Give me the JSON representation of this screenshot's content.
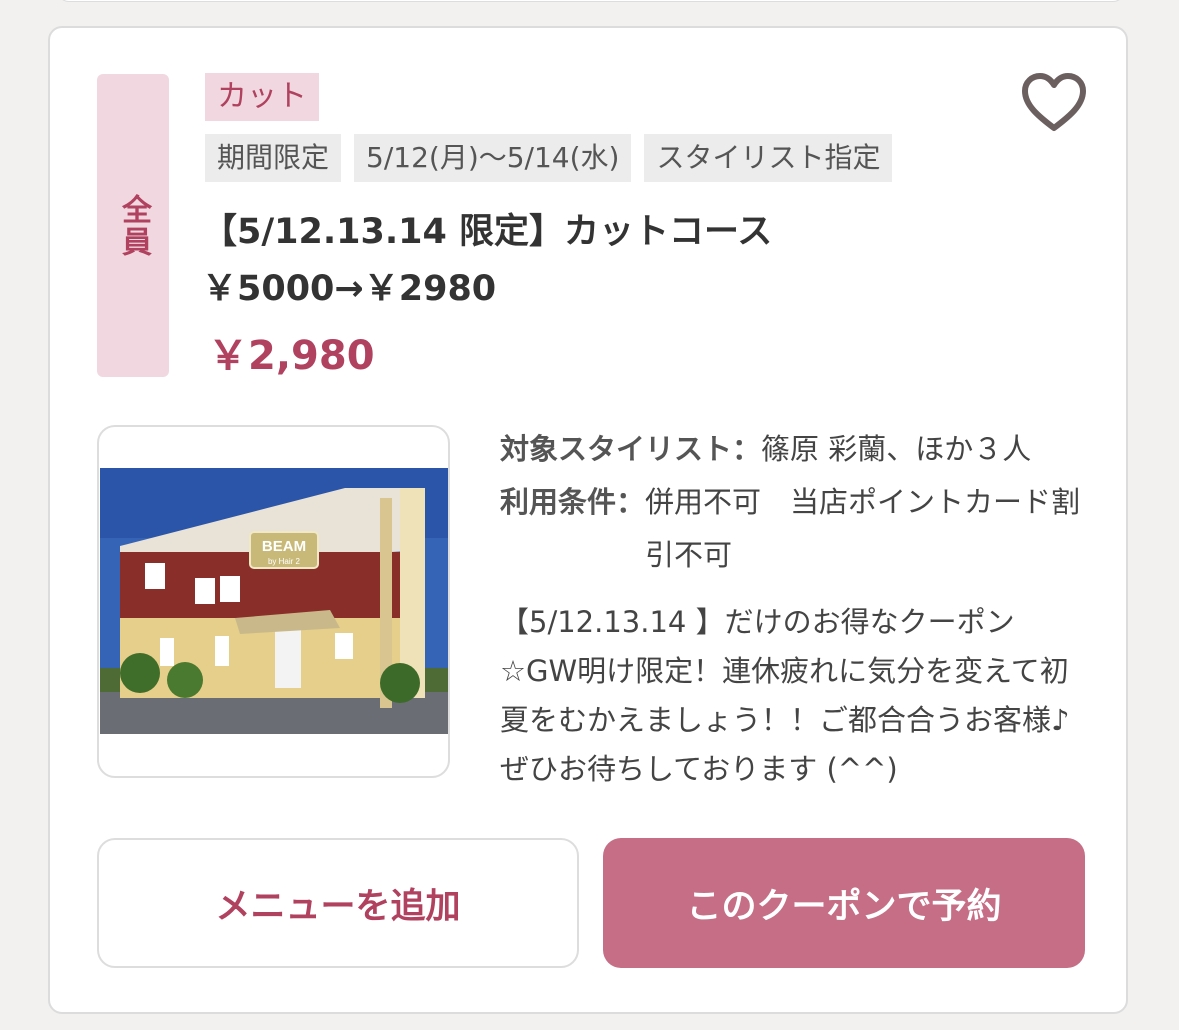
{
  "coupon": {
    "target": "全員",
    "category": "カット",
    "tags": [
      "期間限定",
      "5/12(月)～5/14(水)",
      "スタイリスト指定"
    ],
    "title": "【5/12.13.14 限定】カットコース　￥5000→￥2980",
    "price": "￥2,980",
    "stylist_label": "対象スタイリスト：",
    "stylist_value": "篠原 彩蘭、ほか３人",
    "conditions_label": "利用条件：",
    "conditions_value": "併用不可　当店ポイントカード割引不可",
    "description": "【5/12.13.14 】だけのお得なクーポン☆GW明け限定！連休疲れに気分を変えて初夏をむかえましょう！！ご都合合うお客様♪ぜひお待ちしております (^^)",
    "photo_sign": "BEAM",
    "photo_sign_sub": "by Hair 2"
  },
  "actions": {
    "add_menu": "メニューを追加",
    "reserve": "このクーポンで予約"
  },
  "colors": {
    "accent": "#b0425f",
    "button": "#c56e86",
    "badge_bg": "#f1d8e0"
  },
  "icons": {
    "favorite": "heart-outline-icon"
  }
}
